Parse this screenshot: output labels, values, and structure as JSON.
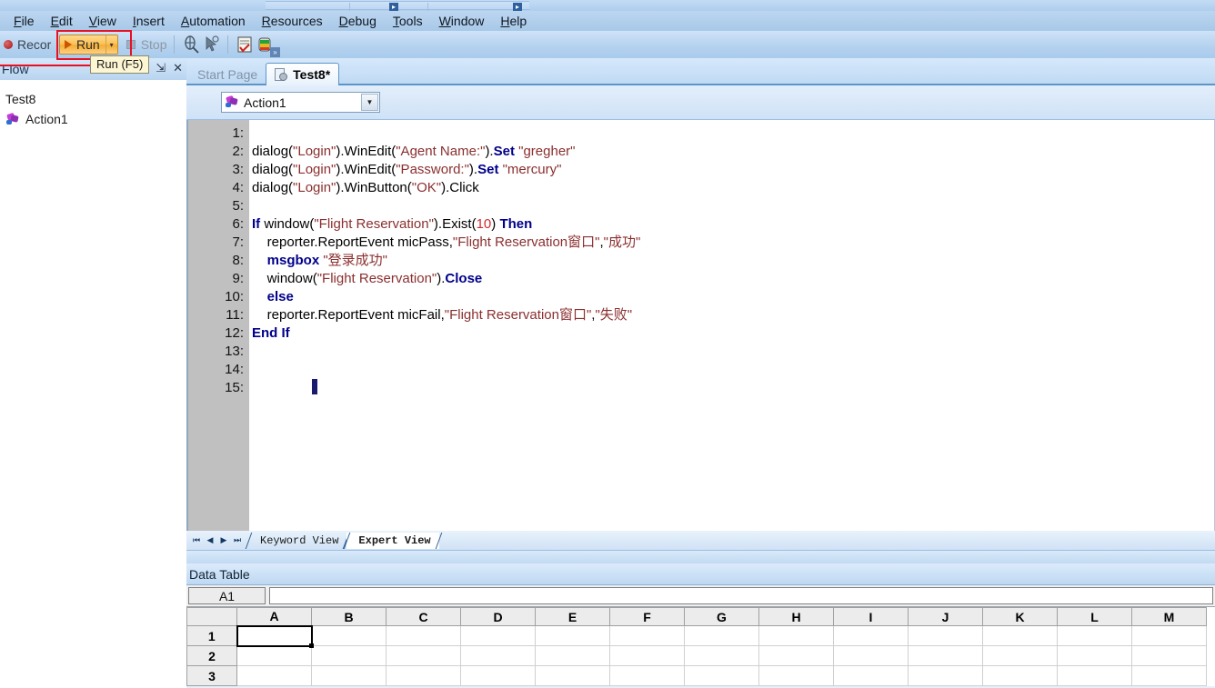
{
  "menubar": {
    "items": [
      {
        "name": "file",
        "accel": "F",
        "rest": "ile"
      },
      {
        "name": "edit",
        "accel": "E",
        "rest": "dit"
      },
      {
        "name": "view",
        "accel": "V",
        "rest": "iew"
      },
      {
        "name": "insert",
        "accel": "I",
        "rest": "nsert"
      },
      {
        "name": "automation",
        "accel": "A",
        "rest": "utomation"
      },
      {
        "name": "resources",
        "accel": "R",
        "rest": "esources"
      },
      {
        "name": "debug",
        "accel": "D",
        "rest": "ebug"
      },
      {
        "name": "tools",
        "accel": "T",
        "rest": "ools"
      },
      {
        "name": "window",
        "accel": "W",
        "rest": "indow"
      },
      {
        "name": "help",
        "accel": "H",
        "rest": "elp"
      }
    ]
  },
  "toolbar": {
    "record_label": "Record",
    "run_label": "Run",
    "run_dropdown_glyph": "▾",
    "stop_label": "Stop",
    "overflow_glyph": "»"
  },
  "tooltip": {
    "text": "Run (F5)"
  },
  "left_panel": {
    "title": "Flow",
    "pin_glyph": "⇲",
    "close_glyph": "✕",
    "tree": [
      {
        "label": "Test8",
        "has_icon": false
      },
      {
        "label": "Action1",
        "has_icon": true
      }
    ]
  },
  "doc_tabs": [
    {
      "label": "Start Page",
      "active": false
    },
    {
      "label": "Test8*",
      "active": true
    }
  ],
  "action_selector": {
    "value": "Action1",
    "arrow_glyph": "▼"
  },
  "editor": {
    "line_numbers": [
      "1:",
      "2:",
      "3:",
      "4:",
      "5:",
      "6:",
      "7:",
      "8:",
      "9:",
      "10:",
      "11:",
      "12:",
      "13:",
      "14:",
      "15:"
    ],
    "lines": [
      {
        "n": 1,
        "tokens": []
      },
      {
        "n": 2,
        "tokens": [
          {
            "t": "plain",
            "v": "dialog("
          },
          {
            "t": "str",
            "v": "\"Login\""
          },
          {
            "t": "plain",
            "v": ").WinEdit("
          },
          {
            "t": "str",
            "v": "\"Agent Name:\""
          },
          {
            "t": "plain",
            "v": ")."
          },
          {
            "t": "kw",
            "v": "Set"
          },
          {
            "t": "plain",
            "v": " "
          },
          {
            "t": "str",
            "v": "\"gregher\""
          }
        ]
      },
      {
        "n": 3,
        "tokens": [
          {
            "t": "plain",
            "v": "dialog("
          },
          {
            "t": "str",
            "v": "\"Login\""
          },
          {
            "t": "plain",
            "v": ").WinEdit("
          },
          {
            "t": "str",
            "v": "\"Password:\""
          },
          {
            "t": "plain",
            "v": ")."
          },
          {
            "t": "kw",
            "v": "Set"
          },
          {
            "t": "plain",
            "v": " "
          },
          {
            "t": "str",
            "v": "\"mercury\""
          }
        ]
      },
      {
        "n": 4,
        "tokens": [
          {
            "t": "plain",
            "v": "dialog("
          },
          {
            "t": "str",
            "v": "\"Login\""
          },
          {
            "t": "plain",
            "v": ").WinButton("
          },
          {
            "t": "str",
            "v": "\"OK\""
          },
          {
            "t": "plain",
            "v": ").Click"
          }
        ]
      },
      {
        "n": 5,
        "tokens": []
      },
      {
        "n": 6,
        "tokens": [
          {
            "t": "kw",
            "v": "If"
          },
          {
            "t": "plain",
            "v": " window("
          },
          {
            "t": "str",
            "v": "\"Flight Reservation\""
          },
          {
            "t": "plain",
            "v": ").Exist("
          },
          {
            "t": "num",
            "v": "10"
          },
          {
            "t": "plain",
            "v": ") "
          },
          {
            "t": "kw",
            "v": "Then"
          }
        ]
      },
      {
        "n": 7,
        "tokens": [
          {
            "t": "plain",
            "v": "    reporter.ReportEvent micPass,"
          },
          {
            "t": "str",
            "v": "\"Flight Reservation窗口\""
          },
          {
            "t": "plain",
            "v": ","
          },
          {
            "t": "str",
            "v": "\"成功\""
          }
        ]
      },
      {
        "n": 8,
        "tokens": [
          {
            "t": "plain",
            "v": "    "
          },
          {
            "t": "kw",
            "v": "msgbox"
          },
          {
            "t": "plain",
            "v": " "
          },
          {
            "t": "str",
            "v": "\"登录成功\""
          }
        ]
      },
      {
        "n": 9,
        "tokens": [
          {
            "t": "plain",
            "v": "    window("
          },
          {
            "t": "str",
            "v": "\"Flight Reservation\""
          },
          {
            "t": "plain",
            "v": ")."
          },
          {
            "t": "kw",
            "v": "Close"
          }
        ]
      },
      {
        "n": 10,
        "tokens": [
          {
            "t": "plain",
            "v": "    "
          },
          {
            "t": "kw",
            "v": "else"
          }
        ]
      },
      {
        "n": 11,
        "tokens": [
          {
            "t": "plain",
            "v": "    reporter.ReportEvent micFail,"
          },
          {
            "t": "str",
            "v": "\"Flight Reservation窗口\""
          },
          {
            "t": "plain",
            "v": ","
          },
          {
            "t": "str",
            "v": "\"失败\""
          }
        ]
      },
      {
        "n": 12,
        "tokens": [
          {
            "t": "kw",
            "v": "End If"
          }
        ]
      },
      {
        "n": 13,
        "tokens": []
      },
      {
        "n": 14,
        "tokens": []
      },
      {
        "n": 15,
        "tokens": []
      }
    ]
  },
  "view_tabs": {
    "nav_glyphs": [
      "⏮",
      "◀",
      "▶",
      "⏭"
    ],
    "tabs": [
      {
        "label": "Keyword View",
        "active": false
      },
      {
        "label": "Expert View",
        "active": true
      }
    ]
  },
  "data_table": {
    "title": "Data Table",
    "name_box": "A1",
    "formula_value": "",
    "columns": [
      "A",
      "B",
      "C",
      "D",
      "E",
      "F",
      "G",
      "H",
      "I",
      "J",
      "K",
      "L",
      "M"
    ],
    "rows": [
      "1",
      "2",
      "3"
    ],
    "selected_cell": "A1"
  },
  "colors": {
    "keyword": "#00008b",
    "string": "#8b2f2f",
    "number": "#d42a2a",
    "annotation_red": "#e81123",
    "run_button": "#f5ad33"
  }
}
